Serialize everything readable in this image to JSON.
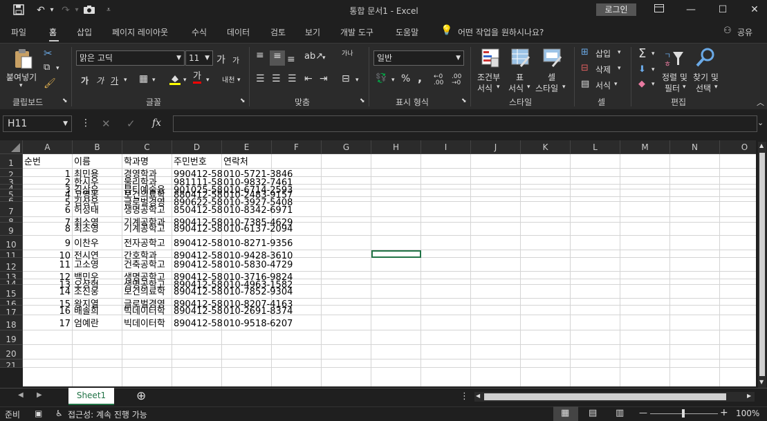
{
  "title_bar": {
    "doc_title": "통합 문서1  -  Excel",
    "login_label": "로그인"
  },
  "tabs": [
    "파일",
    "홈",
    "삽입",
    "페이지 레이아웃",
    "수식",
    "데이터",
    "검토",
    "보기",
    "개발 도구",
    "도움말"
  ],
  "tell_me": "어떤 작업을 원하시나요?",
  "share_label": "공유",
  "ribbon": {
    "clipboard": {
      "label": "클립보드",
      "paste": "붙여넣기"
    },
    "font": {
      "label": "글꼴",
      "font_name": "맑은 고딕",
      "font_size": "11",
      "grow": "가",
      "shrink": "가",
      "bold": "가",
      "italic": "가",
      "underline": "가",
      "font_color": "가",
      "phonetic": "내천"
    },
    "alignment": {
      "label": "맞춤",
      "wrap": "가나"
    },
    "number": {
      "label": "표시 형식",
      "format": "일반",
      "percent": "%",
      "comma": ","
    },
    "styles": {
      "label": "스타일",
      "conditional": "조건부",
      "conditional2": "서식",
      "table": "표",
      "table2": "서식",
      "cell": "셀",
      "cell2": "스타일"
    },
    "cells": {
      "label": "셀",
      "insert": "삽입",
      "delete": "삭제",
      "format": "서식"
    },
    "editing": {
      "label": "편집",
      "sort": "정렬 및",
      "sort2": "필터",
      "find": "찾기 및",
      "find2": "선택"
    }
  },
  "name_box": "H11",
  "formula": "",
  "columns": [
    "A",
    "B",
    "C",
    "D",
    "E",
    "F",
    "G",
    "H",
    "I",
    "J",
    "K",
    "L",
    "M",
    "N",
    "O"
  ],
  "rows": [
    {
      "num": "1",
      "a": "순번",
      "b": "이름",
      "c": "학과명",
      "d": "주민번호",
      "e": "연락처"
    },
    {
      "num": "2",
      "a": "1",
      "b": "최민용",
      "c": "경영학과",
      "d": "990412-58",
      "e": "010-5721-3846"
    },
    {
      "num": "3",
      "a": "2",
      "b": "한시우",
      "c": "물리학과",
      "d": "981111-58",
      "e": "010-9832-7461"
    },
    {
      "num": "4",
      "a": "3",
      "b": "김상우",
      "c": "뷰티예술융",
      "d": "901025-58",
      "e": "010-6714-2593"
    },
    {
      "num": "5",
      "a": "4",
      "b": "고영웅",
      "c": "보건의료학",
      "d": "880412-58",
      "e": "010-2483-9157"
    },
    {
      "num": "6",
      "a": "5",
      "b": "김상우",
      "c": "글로벌경영",
      "d": "890622-58",
      "e": "010-3927-5408"
    },
    {
      "num": "7",
      "a": "6",
      "b": "허성태",
      "c": "생명공학고",
      "d": "850412-58",
      "e": "010-8342-6971"
    },
    {
      "num": "8",
      "a": "7",
      "b": "최소영",
      "c": "기계공학과",
      "d": "890412-58",
      "e": "010-7385-4629"
    },
    {
      "num": "9",
      "a": "8",
      "b": "최소영",
      "c": "기계공학고",
      "d": "890412-58",
      "e": "010-6137-2094"
    },
    {
      "num": "10",
      "a": "9",
      "b": "이찬우",
      "c": "전자공학고",
      "d": "890412-58",
      "e": "010-8271-9356"
    },
    {
      "num": "11",
      "a": "10",
      "b": "전시연",
      "c": "간호학과",
      "d": "890412-58",
      "e": "010-9428-3610"
    },
    {
      "num": "12",
      "a": "11",
      "b": "고소영",
      "c": "건축공학고",
      "d": "890412-58",
      "e": "010-5830-4729"
    },
    {
      "num": "13",
      "a": "12",
      "b": "백민우",
      "c": "생명공학고",
      "d": "890412-58",
      "e": "010-3716-9824"
    },
    {
      "num": "14",
      "a": "13",
      "b": "오상혁",
      "c": "생명공학고",
      "d": "890412-58",
      "e": "010-4963-1582"
    },
    {
      "num": "15",
      "a": "14",
      "b": "조진웅",
      "c": "보건의료학",
      "d": "890412-58",
      "e": "010-7852-9304"
    },
    {
      "num": "16",
      "a": "15",
      "b": "왕지열",
      "c": "글로벌경영",
      "d": "890412-58",
      "e": "010-8207-4163"
    },
    {
      "num": "17",
      "a": "16",
      "b": "배솔희",
      "c": "빅데이터학",
      "d": "890412-58",
      "e": "010-2691-8374"
    },
    {
      "num": "18",
      "a": "17",
      "b": "엄예란",
      "c": "빅데이터학",
      "d": "890412-58",
      "e": "010-9518-6207"
    },
    {
      "num": "19",
      "a": "",
      "b": "",
      "c": "",
      "d": "",
      "e": ""
    },
    {
      "num": "20",
      "a": "",
      "b": "",
      "c": "",
      "d": "",
      "e": ""
    },
    {
      "num": "21",
      "a": "",
      "b": "",
      "c": "",
      "d": "",
      "e": ""
    }
  ],
  "sheet_tab": "Sheet1",
  "status": {
    "ready": "준비",
    "accessibility": "접근성: 계속 진행 가능",
    "zoom": "100%"
  }
}
